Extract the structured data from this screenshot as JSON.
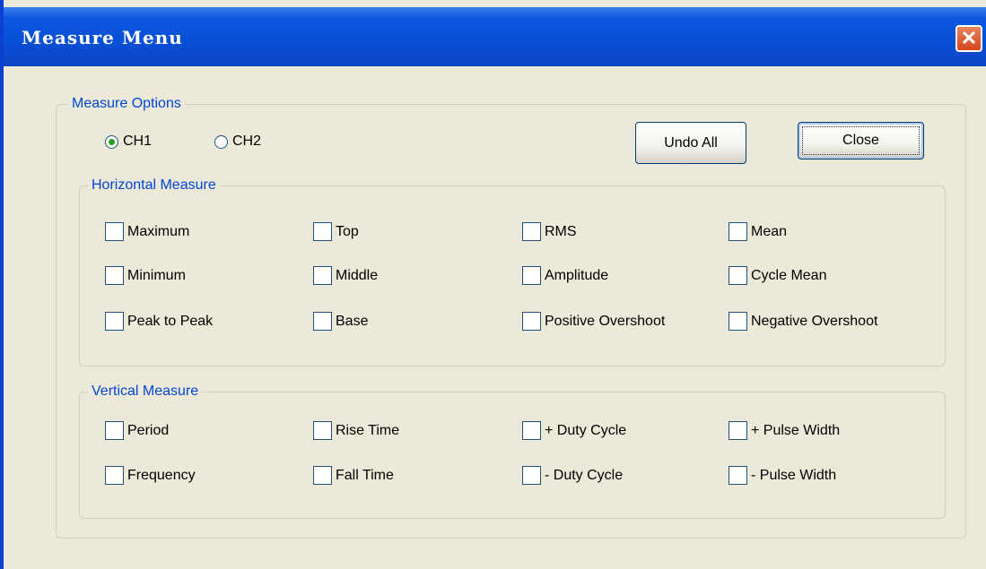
{
  "window": {
    "title": "Measure Menu",
    "close_glyph": "✕"
  },
  "options": {
    "legend": "Measure Options",
    "ch1": "CH1",
    "ch2": "CH2",
    "selected": "CH1",
    "undo_label": "Undo All",
    "close_label": "Close"
  },
  "horizontal": {
    "legend": "Horizontal Measure",
    "items": [
      "Maximum",
      "Top",
      "RMS",
      "Mean",
      "Minimum",
      "Middle",
      "Amplitude",
      "Cycle Mean",
      "Peak to Peak",
      "Base",
      "Positive Overshoot",
      "Negative Overshoot"
    ]
  },
  "vertical": {
    "legend": "Vertical Measure",
    "items": [
      "Period",
      "Rise Time",
      "+ Duty Cycle",
      "+ Pulse Width",
      "Frequency",
      "Fall Time",
      "- Duty Cycle",
      "- Pulse Width"
    ]
  },
  "colors": {
    "titlebar": "#0a4fd6",
    "legend_text": "#0046d5",
    "dialog_bg": "#ece9d8"
  }
}
